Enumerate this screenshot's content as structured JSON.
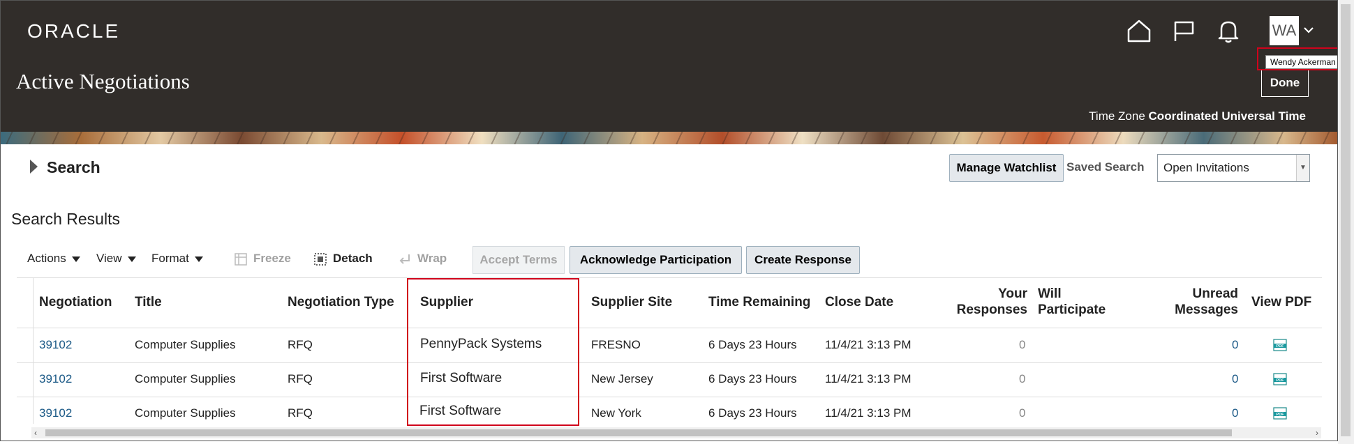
{
  "header": {
    "logo": "ORACLE",
    "user_initials": "WA",
    "user_tooltip": "Wendy Ackerman",
    "page_title": "Active Negotiations",
    "done_label": "Done",
    "timezone_label": "Time Zone",
    "timezone_value": "Coordinated Universal Time"
  },
  "search": {
    "title": "Search",
    "manage_watchlist": "Manage Watchlist",
    "saved_search_label": "Saved Search",
    "saved_search_value": "Open Invitations"
  },
  "results": {
    "title": "Search Results",
    "toolbar": {
      "actions": "Actions",
      "view": "View",
      "format": "Format",
      "freeze": "Freeze",
      "detach": "Detach",
      "wrap": "Wrap",
      "accept_terms": "Accept Terms",
      "acknowledge": "Acknowledge Participation",
      "create_response": "Create Response"
    },
    "columns": {
      "negotiation": "Negotiation",
      "title": "Title",
      "negotiation_type": "Negotiation Type",
      "supplier": "Supplier",
      "supplier_site": "Supplier Site",
      "time_remaining": "Time Remaining",
      "close_date": "Close Date",
      "your_responses_1": "Your",
      "your_responses_2": "Responses",
      "will_participate_1": "Will",
      "will_participate_2": "Participate",
      "unread_1": "Unread",
      "unread_2": "Messages",
      "view_pdf": "View PDF"
    },
    "rows": [
      {
        "negotiation": "39102",
        "title": "Computer Supplies",
        "type": "RFQ",
        "supplier": "PennyPack Systems",
        "site": "FRESNO",
        "time": "6 Days 23 Hours",
        "close": "11/4/21 3:13 PM",
        "responses": "0",
        "unread": "0"
      },
      {
        "negotiation": "39102",
        "title": "Computer Supplies",
        "type": "RFQ",
        "supplier": "First Software",
        "site": "New Jersey",
        "time": "6 Days 23 Hours",
        "close": "11/4/21 3:13 PM",
        "responses": "0",
        "unread": "0"
      },
      {
        "negotiation": "39102",
        "title": "Computer Supplies",
        "type": "RFQ",
        "supplier": "First Software",
        "site": "New York",
        "time": "6 Days 23 Hours",
        "close": "11/4/21 3:13 PM",
        "responses": "0",
        "unread": "0"
      }
    ]
  },
  "colors": {
    "header_bg": "#312d2a",
    "link": "#1c5a87",
    "highlight": "#d0021b"
  },
  "icons": [
    "home-icon",
    "flag-icon",
    "bell-icon",
    "chevron-down-icon",
    "expand-triangle-icon",
    "freeze-icon",
    "detach-icon",
    "wrap-icon",
    "pdf-icon"
  ]
}
